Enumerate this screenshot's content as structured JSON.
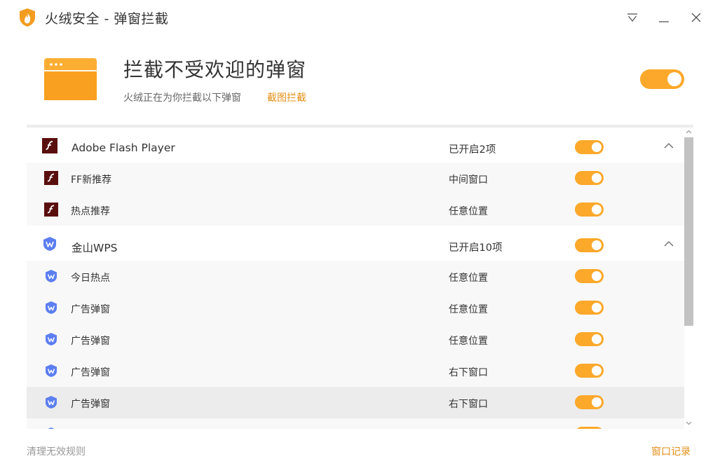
{
  "titlebar": {
    "title": "火绒安全 - 弹窗拦截",
    "logo_icon": "huorong-flame-shield-icon",
    "menu_icon": "dropdown-menu-icon",
    "minimize_icon": "minimize-icon",
    "close_icon": "close-icon"
  },
  "header": {
    "icon": "popup-window-icon",
    "title": "拦截不受欢迎的弹窗",
    "subtitle": "火绒正在为你拦截以下弹窗",
    "screenshot_link": "截图拦截",
    "enabled": true
  },
  "groups": [
    {
      "name": "Adobe Flash Player",
      "icon": "flash-icon",
      "status": "已开启2项",
      "enabled": true,
      "expanded": true,
      "items": [
        {
          "name": "FF新推荐",
          "position": "中间窗口",
          "enabled": true
        },
        {
          "name": "热点推荐",
          "position": "任意位置",
          "enabled": true
        }
      ]
    },
    {
      "name": "金山WPS",
      "icon": "wps-icon",
      "status": "已开启10项",
      "enabled": true,
      "expanded": true,
      "items": [
        {
          "name": "今日热点",
          "position": "任意位置",
          "enabled": true
        },
        {
          "name": "广告弹窗",
          "position": "任意位置",
          "enabled": true
        },
        {
          "name": "广告弹窗",
          "position": "任意位置",
          "enabled": true
        },
        {
          "name": "广告弹窗",
          "position": "右下窗口",
          "enabled": true
        },
        {
          "name": "广告弹窗",
          "position": "右下窗口",
          "enabled": true
        }
      ]
    }
  ],
  "footer": {
    "clean_rules": "清理无效规则",
    "window_log": "窗口记录"
  },
  "colors": {
    "accent": "#fca82a",
    "link": "#e38f17",
    "flash_bg": "#5a0f0f",
    "wps_blue": "#5c7ef0"
  }
}
